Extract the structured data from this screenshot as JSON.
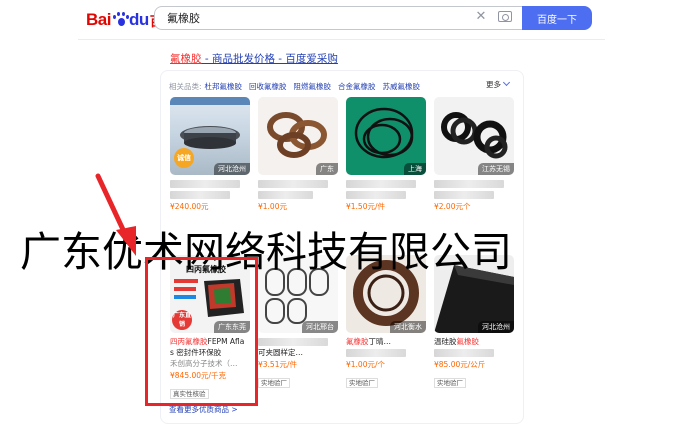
{
  "header": {
    "logo_bai": "Bai",
    "logo_du": "du",
    "logo_cn": "百度",
    "search_value": "氟橡胶",
    "search_button": "百度一下"
  },
  "result": {
    "title_highlight": "氟橡胶",
    "title_rest": " - 商品批发价格 - 百度爱采购"
  },
  "categories": {
    "label": "相关品类:",
    "items": [
      "杜邦氟橡胶",
      "回收氟橡胶",
      "阻燃氟橡胶",
      "合金氟橡胶",
      "苏威氟橡胶"
    ],
    "more": "更多"
  },
  "products": [
    {
      "location": "河北沧州",
      "line1": "",
      "line2": "",
      "price": "¥240.00元",
      "seal": "诚信"
    },
    {
      "location": "广东",
      "line1": "",
      "line2": "",
      "price": "¥1.00元"
    },
    {
      "location": "上海",
      "line1": "",
      "line2": "",
      "price": "¥1.50元/件"
    },
    {
      "location": "江苏无锡",
      "line1": "",
      "line2": "",
      "price": "¥2.00元个"
    },
    {
      "location": "广东东莞",
      "banner": "四丙氟橡胶",
      "badge": "广东直销",
      "line1_red": "四丙氟橡胶",
      "line1_rest": "FEPM Afla",
      "line2": "s 密封件环保胶",
      "line3": "禾创高分子技术（…",
      "price": "¥845.00元/千克",
      "tag": "真实性核验"
    },
    {
      "location": "河北邢台",
      "line1": "",
      "line2": "可夹圆样定…",
      "price": "¥3.51元/件",
      "tag": "实地验厂"
    },
    {
      "location": "河北衡水",
      "line1_red": "氟橡胶",
      "line1_rest": "丁晴…",
      "line2": "",
      "price": "¥1.00元/个",
      "tag": "实地验厂"
    },
    {
      "location": "河北沧州",
      "line1_red": "",
      "line1_rest": "温硅胶",
      "line1_red2": "氟橡胶",
      "line2": "",
      "price": "¥85.00元/公斤",
      "tag": "实地验厂"
    }
  ],
  "more_link": "查看更多优质商品 >",
  "watermark": "广东优术网络科技有限公司",
  "colors": {
    "accent": "#4e6ef2",
    "link": "#2440b3",
    "highlight": "#f73131",
    "price": "#ff6600",
    "annotation": "#e8262a"
  }
}
